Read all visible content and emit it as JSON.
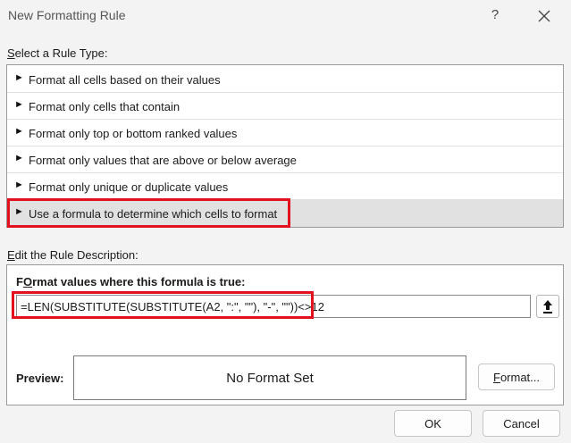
{
  "window": {
    "title": "New Formatting Rule",
    "help_label": "?"
  },
  "rule_type_section": {
    "label_accel": "S",
    "label_rest": "elect a Rule Type:"
  },
  "rule_types": [
    {
      "label": "Format all cells based on their values",
      "selected": false
    },
    {
      "label": "Format only cells that contain",
      "selected": false
    },
    {
      "label": "Format only top or bottom ranked values",
      "selected": false
    },
    {
      "label": "Format only values that are above or below average",
      "selected": false
    },
    {
      "label": "Format only unique or duplicate values",
      "selected": false
    },
    {
      "label": "Use a formula to determine which cells to format",
      "selected": true
    }
  ],
  "rule_arrow_glyph": "►",
  "description_section": {
    "label_accel": "E",
    "label_rest": "dit the Rule Description:",
    "heading_accel": "O",
    "heading_pre": "F",
    "heading_rest": "rmat values where this formula is true:",
    "formula": "=LEN(SUBSTITUTE(SUBSTITUTE(A2, \":\", \"\"), \"-\", \"\"))<>12",
    "preview_label": "Preview:",
    "preview_text": "No Format Set",
    "format_button_accel": "F",
    "format_button_rest": "ormat..."
  },
  "buttons": {
    "ok": "OK",
    "cancel": "Cancel"
  },
  "colors": {
    "highlight": "#e3111e",
    "selected_row": "#e1e1e1"
  },
  "icons": {
    "close": "close-icon",
    "collapse": "upload-arrow-icon",
    "arrow": "arrow-right-icon"
  }
}
